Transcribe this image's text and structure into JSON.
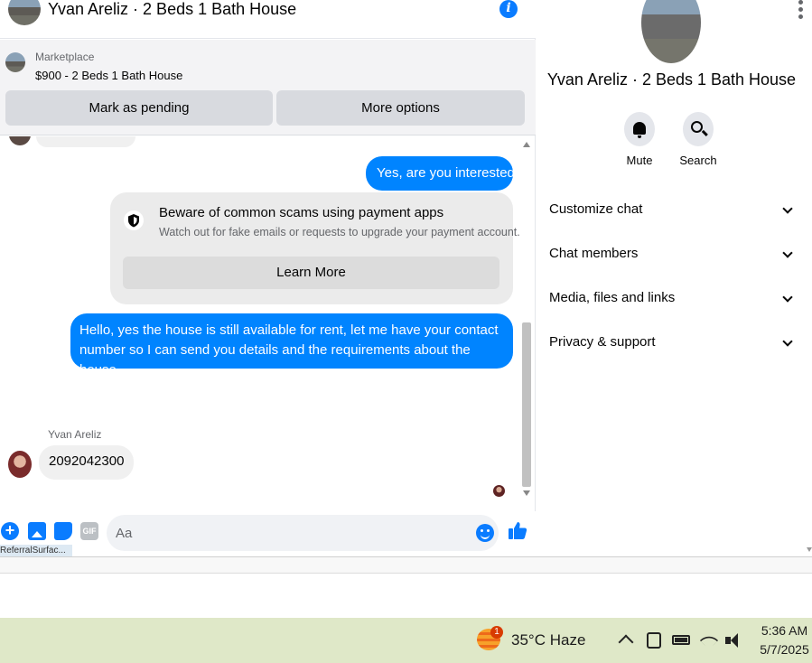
{
  "chat": {
    "title": "Yvan Areliz · 2 Beds 1 Bath House",
    "marketplace": {
      "label": "Marketplace",
      "listing": "$900 - 2 Beds 1 Bath House",
      "pending_button": "Mark as pending",
      "more_button": "More options"
    },
    "messages": {
      "outgoing_1": "Yes, are you interested?",
      "scam_title": "Beware of common scams using payment apps",
      "scam_subtitle": "Watch out for fake emails or requests to upgrade your payment account.",
      "scam_button": "Learn More",
      "outgoing_2": "Hello, yes the house is still available for rent, let me have your contact number so I can send you details and the requirements about the house",
      "sender_name": "Yvan Areliz",
      "incoming_1": "2092042300"
    },
    "composer": {
      "placeholder": "Aa",
      "gif_label": "GIF",
      "ref_tag": "ReferralSurfac..."
    },
    "colors": {
      "accent": "#0084ff",
      "incoming_bubble": "#f0f0f0"
    }
  },
  "info_panel": {
    "name": "Yvan Areliz · 2 Beds 1 Bath House",
    "actions": [
      {
        "label": "Mute",
        "icon": "bell-icon"
      },
      {
        "label": "Search",
        "icon": "search-icon"
      }
    ],
    "sections": [
      {
        "label": "Customize chat"
      },
      {
        "label": "Chat members"
      },
      {
        "label": "Media, files and links"
      },
      {
        "label": "Privacy & support"
      }
    ]
  },
  "taskbar": {
    "weather_badge": "1",
    "weather": "35°C  Haze",
    "time": "5:36 AM",
    "date": "5/7/2025"
  }
}
